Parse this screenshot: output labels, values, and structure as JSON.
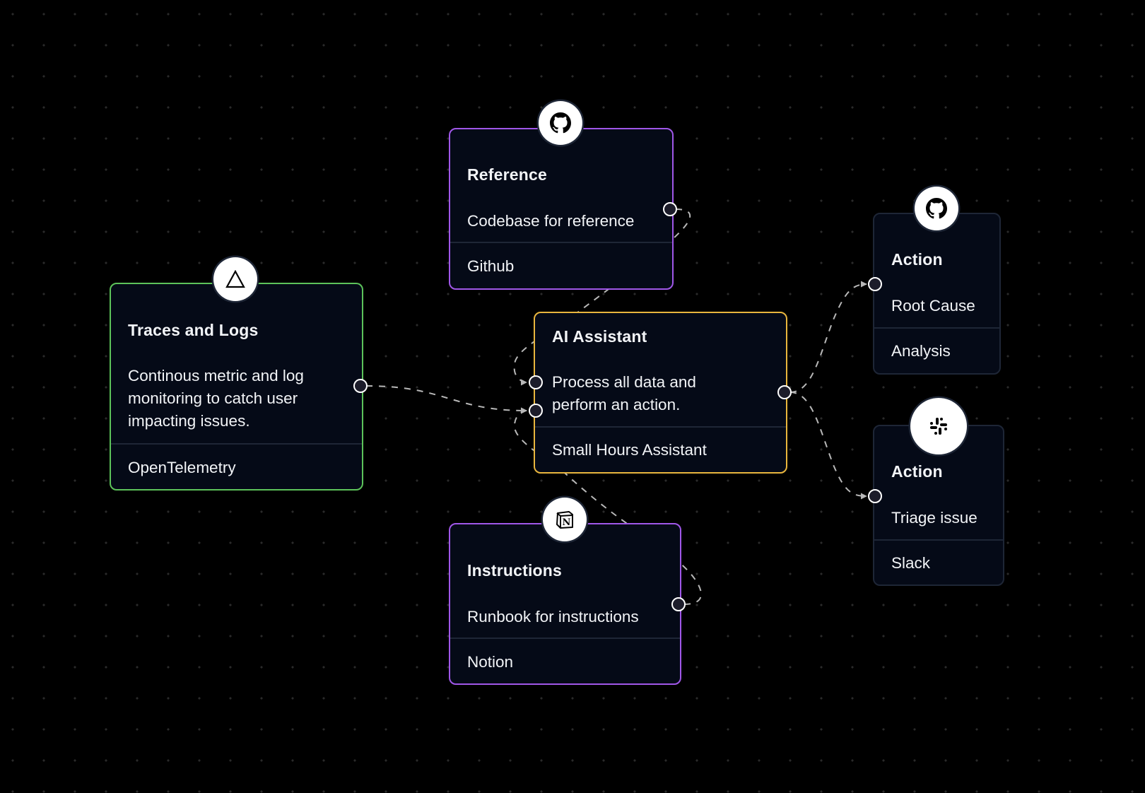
{
  "canvas": {
    "background": "#000000",
    "grid_dot_color": "#2a2a2a",
    "edge_color": "#b8b8b8"
  },
  "nodes": {
    "traces": {
      "title": "Traces and Logs",
      "desc_lines": [
        "Continous metric and log",
        "monitoring to catch user",
        "impacting issues."
      ],
      "footer": "OpenTelemetry",
      "icon": "triangle-icon",
      "border_color": "#5dc35a"
    },
    "reference": {
      "title": "Reference",
      "desc_lines": [
        "Codebase for reference"
      ],
      "footer": "Github",
      "icon": "github-icon",
      "border_color": "#a057e8"
    },
    "assistant": {
      "title": "AI Assistant",
      "desc_lines": [
        "Process all data and",
        "perform an action."
      ],
      "footer": "Small Hours Assistant",
      "icon": null,
      "border_color": "#e9b63e"
    },
    "instructions": {
      "title": "Instructions",
      "desc_lines": [
        "Runbook for instructions"
      ],
      "footer": "Notion",
      "icon": "notion-icon",
      "border_color": "#a057e8"
    },
    "action_rca": {
      "title": "Action",
      "desc_lines": [
        "Root Cause"
      ],
      "footer": "Analysis",
      "icon": "github-icon",
      "border_color": "#1e2636"
    },
    "action_triage": {
      "title": "Action",
      "desc_lines": [
        "Triage issue"
      ],
      "footer": "Slack",
      "icon": "slack-icon",
      "border_color": "#1e2636"
    }
  },
  "edges": [
    {
      "from": "traces",
      "to": "assistant",
      "style": "dashed",
      "arrow": true
    },
    {
      "from": "reference",
      "to": "assistant",
      "style": "dashed",
      "arrow": true
    },
    {
      "from": "instructions",
      "to": "assistant",
      "style": "dashed",
      "arrow": true
    },
    {
      "from": "assistant",
      "to": "action_rca",
      "style": "dashed",
      "arrow": true
    },
    {
      "from": "assistant",
      "to": "action_triage",
      "style": "dashed",
      "arrow": true
    }
  ]
}
